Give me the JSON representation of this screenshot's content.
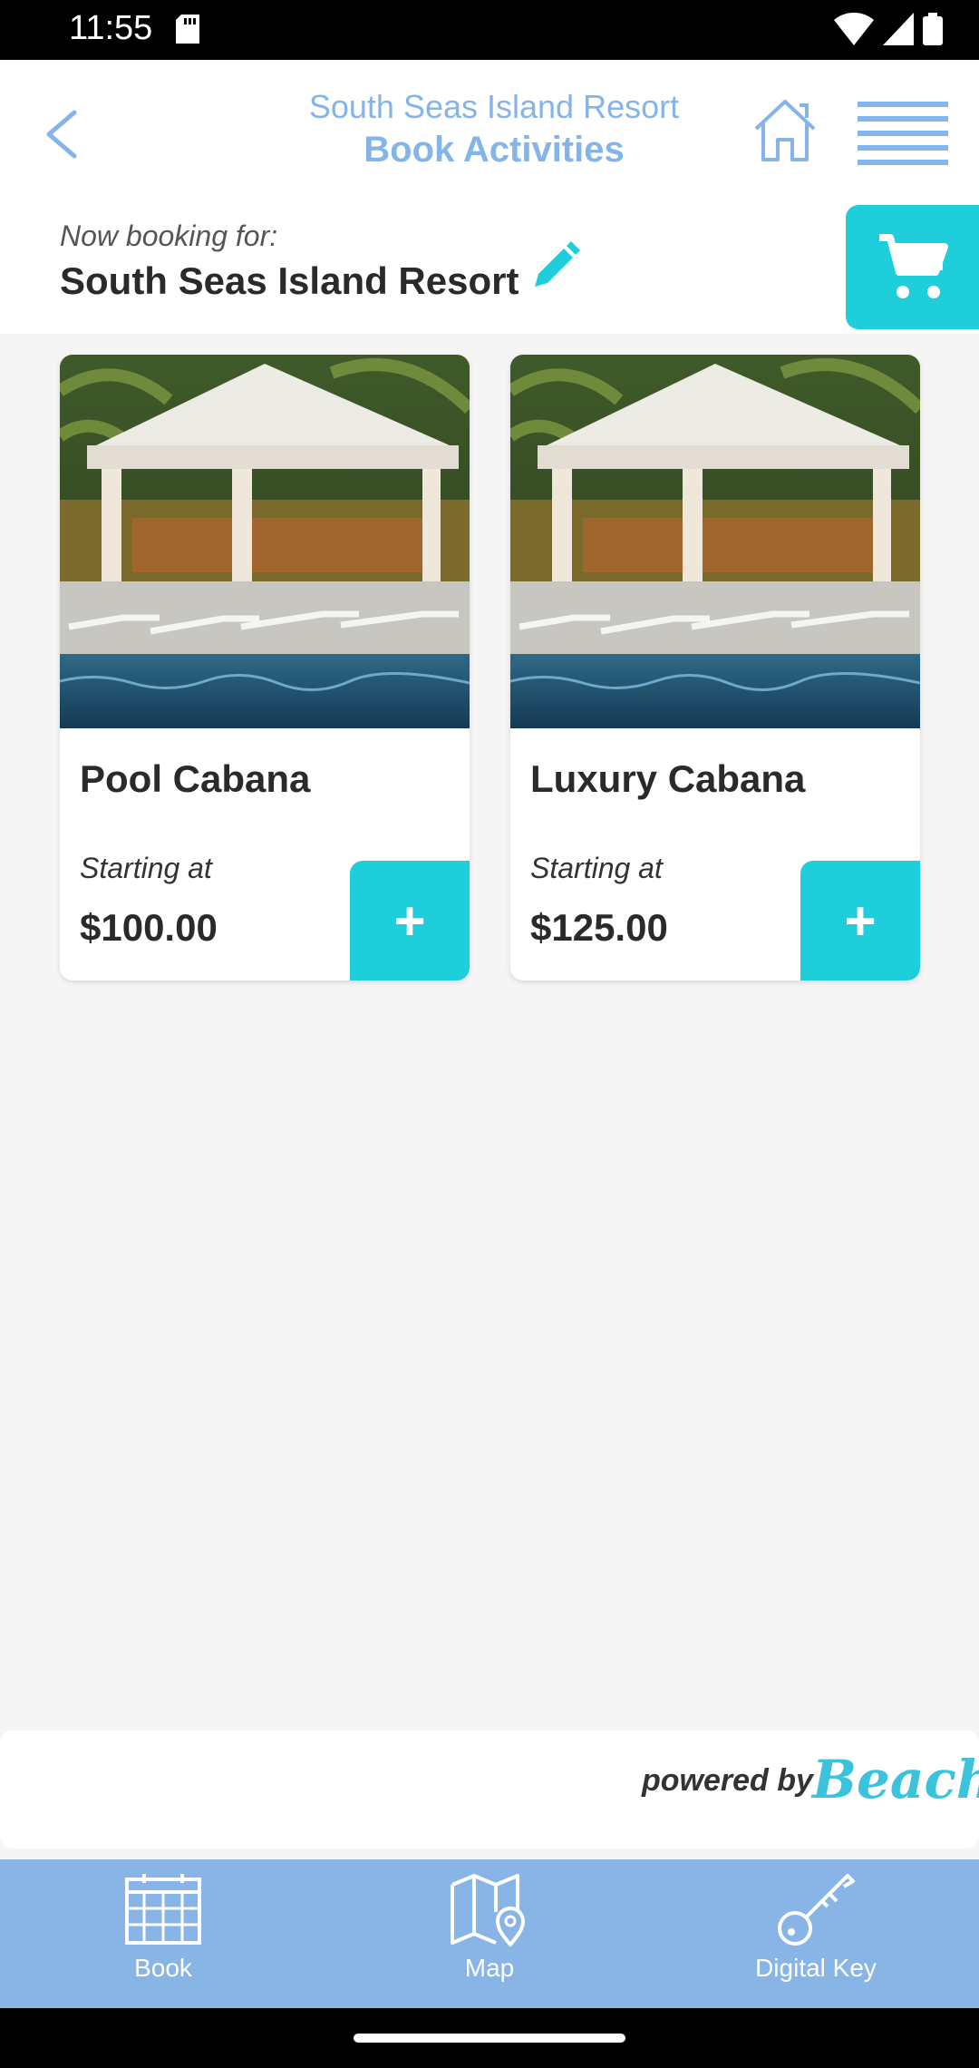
{
  "status_bar": {
    "time": "11:55"
  },
  "header": {
    "resort_name": "South Seas Island Resort",
    "page_title": "Book Activities"
  },
  "booking_for": {
    "label": "Now booking for:",
    "name": "South Seas Island Resort"
  },
  "cards": [
    {
      "name": "Pool Cabana",
      "starting_label": "Starting at",
      "price": "$100.00",
      "add_label": "+"
    },
    {
      "name": "Luxury Cabana",
      "starting_label": "Starting at",
      "price": "$125.00",
      "add_label": "+"
    }
  ],
  "footer": {
    "powered_by": "powered by",
    "brand": "Beachy"
  },
  "bottom_nav": [
    {
      "label": "Book",
      "icon": "calendar-icon"
    },
    {
      "label": "Map",
      "icon": "map-pin-icon"
    },
    {
      "label": "Digital Key",
      "icon": "key-icon"
    }
  ],
  "colors": {
    "accent": "#1ecfdb",
    "header_blue": "#85b4e8",
    "nav_blue": "#88b4e6"
  }
}
